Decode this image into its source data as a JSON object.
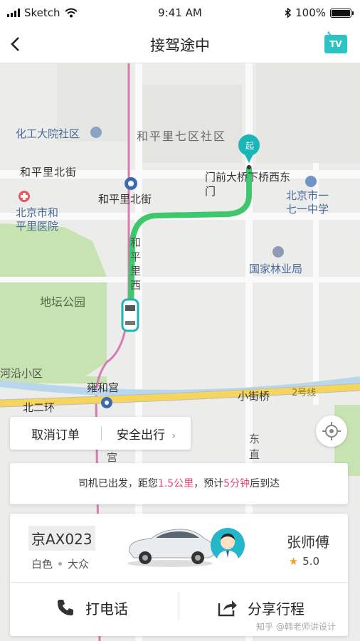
{
  "status_bar": {
    "carrier": "Sketch",
    "time": "9:41 AM",
    "battery": "100%"
  },
  "nav": {
    "title": "接驾途中",
    "tv_label": "TV"
  },
  "map": {
    "start_marker": "起",
    "labels": {
      "huagong": "化工大院社区",
      "heping7": "和平里七区社区",
      "hepingbei_street": "和平里北街",
      "hepingbei_station": "和平里北街",
      "menqian": "门前大桥下桥西东",
      "menqian2": "门",
      "beijing171_1": "北京市一",
      "beijing171_2": "七一中学",
      "hospital1": "北京市和",
      "hospital2": "平里医院",
      "forestry": "国家林业局",
      "ditan": "地坛公园",
      "heyan": "河沿小区",
      "yonghegong": "雍和宫",
      "xiaojieqiao": "小街桥",
      "line2": "2号线",
      "beierhuan": "北二环",
      "heping_v1": "和",
      "heping_v2": "平",
      "heping_v3": "里",
      "heping_v4": "西",
      "dongzhi1": "东",
      "dongzhi2": "直",
      "gongwang": "宫"
    },
    "colors": {
      "route": "#3ec76d",
      "marker": "#19b5b7"
    }
  },
  "actions": {
    "cancel": "取消订单",
    "safety": "安全出行"
  },
  "notice": {
    "prefix": "司机已出发，距您",
    "distance": "1.5公里",
    "middle": "，预计",
    "eta": "5分钟",
    "suffix": "后到达"
  },
  "driver_card": {
    "plate": "京AX023",
    "car_color": "白色",
    "car_model": "大众",
    "driver_name": "张师傅",
    "rating": "5.0",
    "call_label": "打电话",
    "share_label": "分享行程"
  },
  "watermark": "知乎 @韩老师讲设计"
}
